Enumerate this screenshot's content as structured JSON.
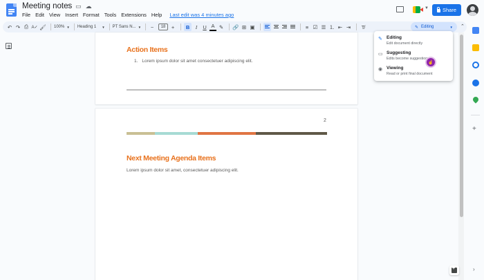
{
  "title_bar": {
    "doc_title": "Meeting notes",
    "icons": [
      "star-icon",
      "folder-move-icon",
      "cloud-status-icon"
    ],
    "menu": [
      "File",
      "Edit",
      "View",
      "Insert",
      "Format",
      "Tools",
      "Extensions",
      "Help"
    ],
    "last_edit": "Last edit was 4 minutes ago",
    "share_label": "Share"
  },
  "toolbar": {
    "zoom": "100%",
    "style": "Heading 1",
    "font": "PT Sans N...",
    "font_size": "18",
    "bold_label": "B",
    "italic_label": "I",
    "underline_label": "U",
    "text_color_label": "A",
    "mode_label": "Editing"
  },
  "mode_menu": {
    "items": [
      {
        "icon": "pencil-icon",
        "title": "Editing",
        "desc": "Edit document directly"
      },
      {
        "icon": "suggest-icon",
        "title": "Suggesting",
        "desc": "Edits become suggestions"
      },
      {
        "icon": "eye-icon",
        "title": "Viewing",
        "desc": "Read or print final document"
      }
    ]
  },
  "page1": {
    "heading": "Action Items",
    "list_number": "1.",
    "list_item": "Lorem ipsum dolor sit amet consectetuer adipiscing elit."
  },
  "page2": {
    "page_number": "2",
    "heading": "Next Meeting Agenda Items",
    "body": "Lorem ipsum dolor sit amet, consectetuer adipiscing elit.",
    "color_bar": [
      "#c9bf94",
      "#a6dad4",
      "#e07543",
      "#5f5847"
    ]
  },
  "colors": {
    "accent": "#1a73e8",
    "heading_orange": "#e8711c",
    "cursor_purple": "#8e24aa"
  }
}
